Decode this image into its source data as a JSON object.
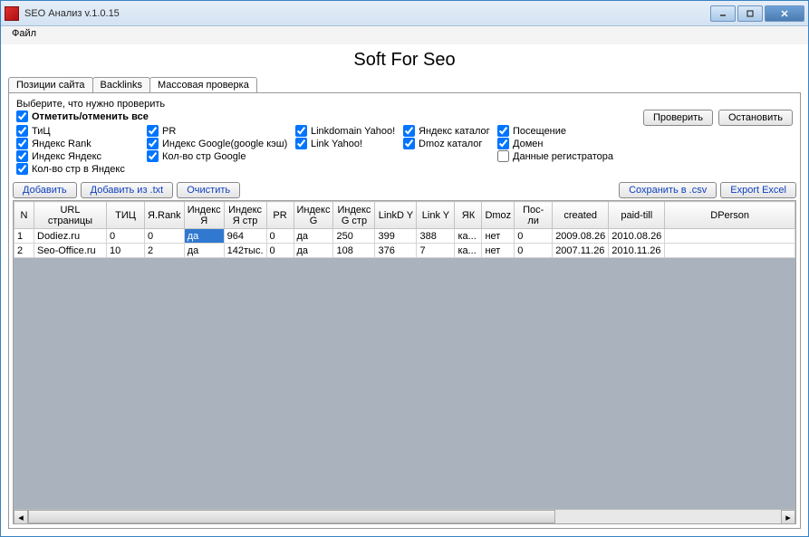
{
  "window": {
    "title": "SEO Анализ v.1.0.15"
  },
  "menu": {
    "file": "Файл"
  },
  "brand": "Soft For Seo",
  "tabs": [
    {
      "label": "Позиции сайта"
    },
    {
      "label": "Backlinks"
    },
    {
      "label": "Массовая проверка"
    }
  ],
  "checks": {
    "title": "Выберите, что нужно проверить",
    "all": "Отметить/отменить все",
    "col1": [
      "ТиЦ",
      "Яндекс Rank",
      "Индекс Яндекс",
      "Кол-во стр в Яндекс"
    ],
    "col2": [
      "PR",
      "Индекс Google(google кэш)",
      "Кол-во стр Google"
    ],
    "col3": [
      "Linkdomain Yahoo!",
      "Link Yahoo!"
    ],
    "col4": [
      "Яндекс каталог",
      "Dmoz каталог"
    ],
    "col5": [
      {
        "label": "Посещение",
        "checked": true
      },
      {
        "label": "Домен",
        "checked": true
      },
      {
        "label": "Данные регистратора",
        "checked": false
      }
    ]
  },
  "buttons": {
    "check": "Проверить",
    "stop": "Остановить",
    "add": "Добавить",
    "addTxt": "Добавить из .txt",
    "clear": "Очистить",
    "saveCsv": "Сохранить в .csv",
    "exportExcel": "Export Excel"
  },
  "table": {
    "headers": [
      "N",
      "URL страницы",
      "ТИЦ",
      "Я.Rank",
      "Индекс Я",
      "Индекс Я стр",
      "PR",
      "Индекс G",
      "Индекс G стр",
      "LinkD Y",
      "Link Y",
      "ЯК",
      "Dmoz",
      "Пос-ли",
      "created",
      "paid-till",
      "DPerson"
    ],
    "rows": [
      {
        "n": "1",
        "url": "Dodiez.ru",
        "tic": "0",
        "yrank": "0",
        "iy": "да",
        "iystr": "964",
        "pr": "0",
        "ig": "да",
        "igstr": "250",
        "ldy": "399",
        "ly": "388",
        "yk": "ка...",
        "dmoz": "нет",
        "pos": "0",
        "created": "2009.08.26",
        "paid": "2010.08.26",
        "dp": ""
      },
      {
        "n": "2",
        "url": "Seo-Office.ru",
        "tic": "10",
        "yrank": "2",
        "iy": "да",
        "iystr": "142тыс.",
        "pr": "0",
        "ig": "да",
        "igstr": "108",
        "ldy": "376",
        "ly": "7",
        "yk": "ка...",
        "dmoz": "нет",
        "pos": "0",
        "created": "2007.11.26",
        "paid": "2010.11.26",
        "dp": ""
      }
    ]
  }
}
